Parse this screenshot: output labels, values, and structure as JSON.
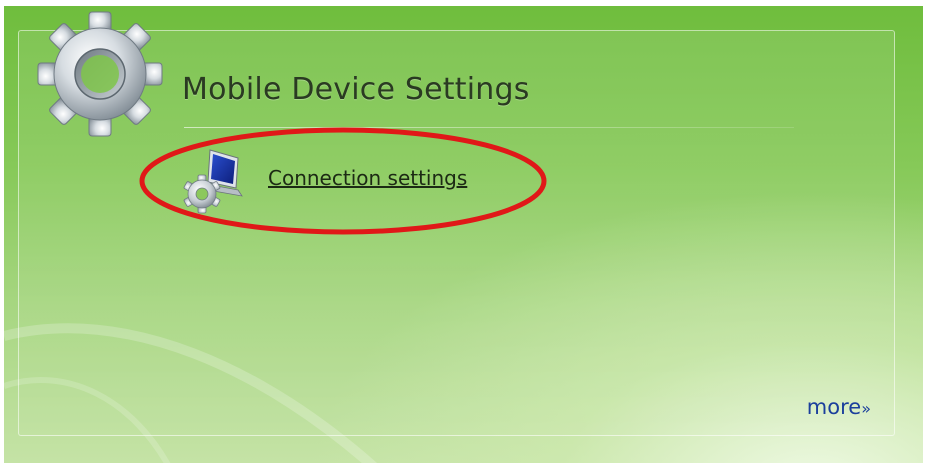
{
  "panel": {
    "title": "Mobile Device Settings",
    "link_label": "Connection settings",
    "more_label": "more",
    "more_suffix": "»"
  },
  "icons": {
    "header": "gear-icon",
    "connection": "connection-settings-icon"
  },
  "colors": {
    "background_top": "#6fbd3d",
    "background_bottom": "#c5e3a6",
    "highlight_ellipse": "#e01818",
    "link_color": "#1b3f9c"
  }
}
